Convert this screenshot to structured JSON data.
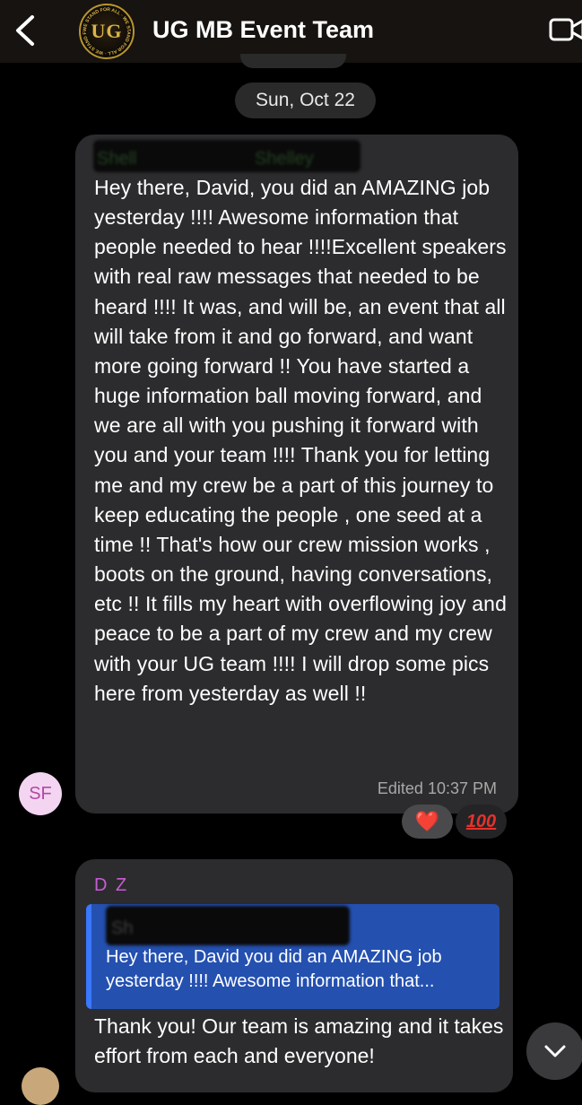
{
  "header": {
    "title": "UG MB Event Team",
    "logo_text": "UG",
    "logo_ring_text": "WE STAND FOR ALL · WE STAND FOR ALL · WE STAND FOR ALL ·",
    "back_icon": "chevron-left-icon",
    "video_icon": "video-camera-icon"
  },
  "date_separator": "Sun, Oct 22",
  "messages": [
    {
      "sender_redacted_fragments": [
        "Shell",
        "Shelley"
      ],
      "text": "Hey there, David, you did an AMAZING job yesterday  !!!! Awesome information that people needed to hear !!!!Excellent speakers with real raw messages that needed to be heard !!!! It was,  and will be, an event that all will take from it and go forward, and want more going forward !! You have started a huge information ball moving forward, and we are all with you pushing it forward with you and your team !!!! Thank you for letting me and my crew be a part of this journey to keep educating the people , one seed at a time !! That's how our crew mission works , boots on the ground, having conversations, etc !! It fills my heart with overflowing joy and peace to be a part of my crew and my crew with your UG team !!!! I will drop some pics here from yesterday as well !!",
      "edited_label": "Edited",
      "time": "10:37 PM",
      "avatar_initials": "SF",
      "reactions": [
        {
          "icon": "red-heart-icon",
          "glyph": "❤️"
        },
        {
          "icon": "hundred-points-icon",
          "glyph": "100"
        }
      ]
    },
    {
      "sender": "D Z",
      "quote_redacted_fragment": "Sh",
      "quote_text": "Hey there, David you did an AMAZING job yesterday  !!!! Awesome information that...",
      "text": "Thank you!  Our team is amazing and it takes effort from each and everyone!"
    }
  ],
  "colors": {
    "background": "#000000",
    "bubble": "#2c2c2e",
    "quote": "#2450b0",
    "sender_accent": "#c85cd6",
    "avatar_bg": "#f3d5f1"
  },
  "scroll_icon": "chevron-down-icon"
}
